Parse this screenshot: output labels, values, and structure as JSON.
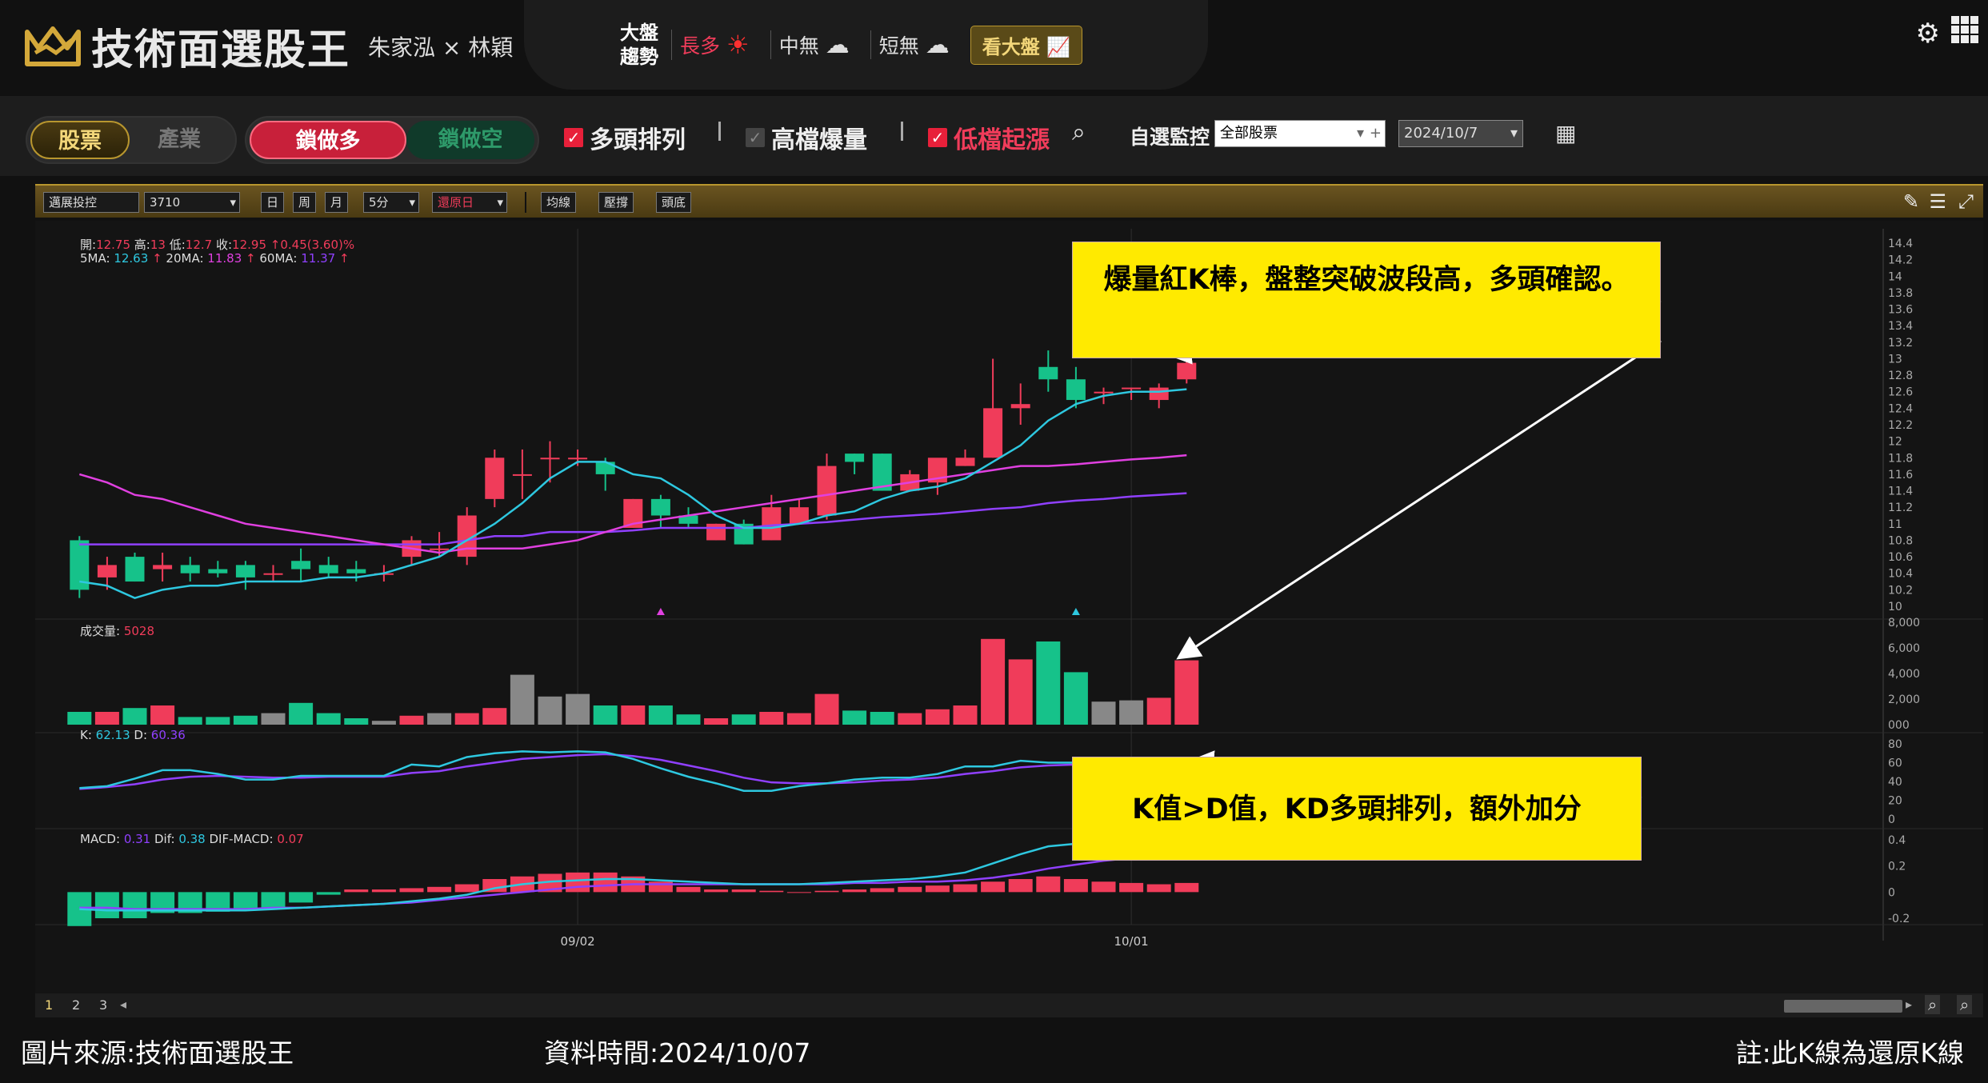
{
  "app": {
    "title": "技術面選股王",
    "authors": "朱家泓 × 林穎"
  },
  "market": {
    "label_line1": "大盤",
    "label_line2": "趨勢",
    "long": "長多",
    "mid": "中無",
    "short": "短無",
    "view_button": "看大盤"
  },
  "toolbar": {
    "seg1": [
      "股票",
      "產業"
    ],
    "seg2": [
      "鎖做多",
      "鎖做空"
    ],
    "filters": [
      {
        "label": "多頭排列",
        "checked": true
      },
      {
        "label": "高檔爆量",
        "checked": false
      },
      {
        "label": "低檔起漲",
        "checked": true
      }
    ],
    "monitor_label": "自選監控",
    "monitor_value": "全部股票",
    "date_value": "2024/10/7"
  },
  "chart_toolbar": {
    "stock_name": "邁展投控",
    "stock_code": "3710",
    "periods": [
      "日",
      "周",
      "月"
    ],
    "interval": "5分",
    "adjust": "還原日",
    "buttons": [
      "均線",
      "壓撐",
      "頭底"
    ]
  },
  "colors": {
    "up": "#f03c5a",
    "down": "#16c28a",
    "flat": "#888888",
    "ma5": "#2ec8e0",
    "ma20": "#e040e0",
    "ma60": "#9040ff",
    "k": "#2ec8e0",
    "d": "#9040ff",
    "dif": "#2ec8e0",
    "macd": "#9040ff",
    "callout": "#ffea00"
  },
  "info": {
    "ohlc": [
      {
        "label": "開:",
        "value": "12.75"
      },
      {
        "label": "高:",
        "value": "13"
      },
      {
        "label": "低:",
        "value": "12.7"
      },
      {
        "label": "收:",
        "value": "12.95"
      },
      {
        "label": "",
        "value": "↑0.45(3.60)%"
      }
    ],
    "ma": [
      {
        "label": "5MA:",
        "value": "12.63",
        "arrow": "↑"
      },
      {
        "label": "20MA:",
        "value": "11.83",
        "arrow": "↑"
      },
      {
        "label": "60MA:",
        "value": "11.37",
        "arrow": "↑"
      }
    ],
    "volume_label": "成交量:",
    "volume_value": "5028",
    "k_label": "K:",
    "k_value": "62.13",
    "d_label": "D:",
    "d_value": "60.36",
    "macd_label": "MACD:",
    "macd_value": "0.31",
    "dif_label": "Dif:",
    "dif_value": "0.38",
    "difmacd_label": "DIF-MACD:",
    "difmacd_value": "0.07"
  },
  "chart_data": {
    "type": "candlestick",
    "price_axis": {
      "min": 10,
      "max": 14.4,
      "ticks": [
        "14.4",
        "14.2",
        "14",
        "13.8",
        "13.6",
        "13.4",
        "13.2",
        "13",
        "12.8",
        "12.6",
        "12.4",
        "12.2",
        "12",
        "11.8",
        "11.6",
        "11.4",
        "11.2",
        "11",
        "10.8",
        "10.6",
        "10.4",
        "10.2",
        "10"
      ]
    },
    "volume_axis": {
      "min": 0,
      "max": 8000,
      "ticks": [
        "8,000",
        "6,000",
        "4,000",
        "2,000",
        "000"
      ]
    },
    "kd_axis": {
      "min": 0,
      "max": 80,
      "ticks": [
        "80",
        "60",
        "40",
        "20",
        "0"
      ]
    },
    "macd_axis": {
      "min": -0.2,
      "max": 0.4,
      "ticks": [
        "0.4",
        "0.2",
        "0",
        "-0.2"
      ]
    },
    "x_labels": [
      {
        "index": 18,
        "label": "09/02"
      },
      {
        "index": 38,
        "label": "10/01"
      }
    ],
    "candles": [
      [
        10.8,
        10.2,
        10.85,
        10.1
      ],
      [
        10.35,
        10.5,
        10.6,
        10.2
      ],
      [
        10.6,
        10.3,
        10.65,
        10.3
      ],
      [
        10.45,
        10.5,
        10.65,
        10.3
      ],
      [
        10.5,
        10.4,
        10.6,
        10.3
      ],
      [
        10.45,
        10.4,
        10.55,
        10.35
      ],
      [
        10.5,
        10.35,
        10.55,
        10.2
      ],
      [
        10.4,
        10.4,
        10.5,
        10.3
      ],
      [
        10.55,
        10.45,
        10.7,
        10.3
      ],
      [
        10.5,
        10.4,
        10.6,
        10.35
      ],
      [
        10.45,
        10.4,
        10.55,
        10.3
      ],
      [
        10.4,
        10.4,
        10.5,
        10.3
      ],
      [
        10.6,
        10.8,
        10.85,
        10.5
      ],
      [
        10.7,
        10.7,
        10.9,
        10.6
      ],
      [
        10.6,
        11.1,
        11.2,
        10.5
      ],
      [
        11.3,
        11.8,
        11.9,
        11.2
      ],
      [
        11.6,
        11.6,
        11.9,
        11.3
      ],
      [
        11.8,
        11.8,
        12.0,
        11.5
      ],
      [
        11.8,
        11.8,
        11.9,
        11.7
      ],
      [
        11.75,
        11.6,
        11.8,
        11.4
      ],
      [
        10.95,
        11.3,
        11.3,
        10.95
      ],
      [
        11.3,
        11.1,
        11.35,
        10.95
      ],
      [
        11.1,
        11.0,
        11.2,
        10.95
      ],
      [
        10.8,
        11.0,
        11.0,
        10.8
      ],
      [
        11.0,
        10.75,
        11.05,
        10.75
      ],
      [
        10.8,
        11.2,
        11.35,
        10.8
      ],
      [
        11.0,
        11.2,
        11.3,
        11.0
      ],
      [
        11.1,
        11.7,
        11.85,
        11.05
      ],
      [
        11.85,
        11.75,
        11.85,
        11.6
      ],
      [
        11.85,
        11.4,
        11.85,
        11.4
      ],
      [
        11.4,
        11.6,
        11.65,
        11.4
      ],
      [
        11.5,
        11.8,
        11.75,
        11.35
      ],
      [
        11.7,
        11.8,
        11.9,
        11.7
      ],
      [
        11.8,
        12.4,
        13.0,
        11.8
      ],
      [
        12.4,
        12.45,
        12.7,
        12.2
      ],
      [
        12.9,
        12.75,
        13.1,
        12.6
      ],
      [
        12.75,
        12.5,
        12.9,
        12.4
      ],
      [
        12.6,
        12.6,
        12.65,
        12.45
      ],
      [
        12.65,
        12.65,
        12.65,
        12.5
      ],
      [
        12.5,
        12.65,
        12.7,
        12.4
      ],
      [
        12.75,
        12.95,
        13.0,
        12.7
      ]
    ],
    "volume": [
      1000,
      1000,
      1300,
      1500,
      600,
      600,
      700,
      900,
      1700,
      900,
      500,
      300,
      700,
      900,
      900,
      1300,
      3900,
      2200,
      2400,
      1500,
      1500,
      1500,
      800,
      500,
      800,
      1000,
      900,
      2400,
      1100,
      1000,
      900,
      1200,
      1500,
      6700,
      5100,
      6500,
      4100,
      1800,
      1900,
      2100,
      5028
    ],
    "ma5": [
      10.3,
      10.25,
      10.1,
      10.2,
      10.25,
      10.25,
      10.3,
      10.3,
      10.3,
      10.35,
      10.35,
      10.4,
      10.5,
      10.6,
      10.8,
      11.0,
      11.25,
      11.55,
      11.75,
      11.75,
      11.6,
      11.55,
      11.35,
      11.1,
      10.95,
      10.95,
      11.0,
      11.1,
      11.15,
      11.3,
      11.4,
      11.45,
      11.55,
      11.75,
      11.95,
      12.25,
      12.45,
      12.55,
      12.6,
      12.6,
      12.63
    ],
    "ma20": [
      11.6,
      11.5,
      11.35,
      11.3,
      11.2,
      11.1,
      11.0,
      10.95,
      10.9,
      10.85,
      10.8,
      10.75,
      10.7,
      10.65,
      10.7,
      10.7,
      10.7,
      10.75,
      10.8,
      10.9,
      11.0,
      11.05,
      11.1,
      11.15,
      11.2,
      11.25,
      11.3,
      11.35,
      11.4,
      11.45,
      11.5,
      11.55,
      11.6,
      11.65,
      11.7,
      11.7,
      11.72,
      11.75,
      11.78,
      11.8,
      11.83
    ],
    "ma60": [
      10.75,
      10.75,
      10.75,
      10.75,
      10.75,
      10.75,
      10.75,
      10.75,
      10.75,
      10.75,
      10.75,
      10.75,
      10.75,
      10.75,
      10.8,
      10.85,
      10.85,
      10.9,
      10.9,
      10.9,
      10.92,
      10.95,
      10.95,
      10.95,
      10.95,
      10.98,
      11.0,
      11.02,
      11.05,
      11.08,
      11.1,
      11.12,
      11.15,
      11.18,
      11.2,
      11.25,
      11.28,
      11.3,
      11.33,
      11.35,
      11.37
    ],
    "k": [
      33,
      35,
      43,
      52,
      52,
      48,
      42,
      42,
      46,
      46,
      46,
      46,
      58,
      56,
      66,
      70,
      72,
      71,
      72,
      71,
      64,
      54,
      45,
      38,
      30,
      30,
      35,
      38,
      42,
      44,
      44,
      48,
      56,
      56,
      62,
      60,
      60,
      56,
      52,
      43,
      62.13
    ],
    "d": [
      32,
      34,
      37,
      42,
      45,
      46,
      45,
      44,
      44,
      45,
      45,
      45,
      49,
      51,
      56,
      60,
      64,
      66,
      68,
      69,
      67,
      63,
      57,
      51,
      44,
      39,
      38,
      38,
      39,
      41,
      42,
      44,
      48,
      51,
      55,
      57,
      58,
      58,
      56,
      52,
      60.36
    ],
    "dif": [
      -0.13,
      -0.14,
      -0.14,
      -0.14,
      -0.14,
      -0.14,
      -0.14,
      -0.13,
      -0.12,
      -0.11,
      -0.1,
      -0.09,
      -0.07,
      -0.05,
      -0.02,
      0.03,
      0.06,
      0.08,
      0.09,
      0.1,
      0.1,
      0.09,
      0.08,
      0.07,
      0.06,
      0.06,
      0.06,
      0.07,
      0.08,
      0.09,
      0.1,
      0.12,
      0.15,
      0.22,
      0.29,
      0.35,
      0.37,
      0.37,
      0.37,
      0.36,
      0.38
    ],
    "macd": [
      -0.12,
      -0.12,
      -0.13,
      -0.13,
      -0.13,
      -0.13,
      -0.13,
      -0.12,
      -0.12,
      -0.11,
      -0.1,
      -0.09,
      -0.08,
      -0.06,
      -0.04,
      -0.02,
      0,
      0.02,
      0.04,
      0.05,
      0.06,
      0.06,
      0.06,
      0.06,
      0.06,
      0.06,
      0.06,
      0.06,
      0.07,
      0.07,
      0.08,
      0.08,
      0.09,
      0.11,
      0.14,
      0.18,
      0.21,
      0.24,
      0.26,
      0.28,
      0.31
    ],
    "osc": [
      -0.26,
      -0.2,
      -0.2,
      -0.16,
      -0.16,
      -0.15,
      -0.14,
      -0.12,
      -0.08,
      -0.02,
      0.02,
      0.02,
      0.03,
      0.04,
      0.06,
      0.1,
      0.12,
      0.14,
      0.15,
      0.15,
      0.12,
      0.08,
      0.04,
      0.02,
      0.02,
      0.01,
      0.0,
      0.01,
      0.02,
      0.03,
      0.04,
      0.05,
      0.06,
      0.08,
      0.1,
      0.12,
      0.1,
      0.08,
      0.07,
      0.06,
      0.07
    ],
    "markers": [
      {
        "index": 21,
        "color": "#e040e0"
      },
      {
        "index": 36,
        "color": "#2ec8e0"
      }
    ]
  },
  "callouts": [
    {
      "text": "爆量紅K棒，盤整突破波段高，多頭確認。"
    },
    {
      "text": "K值>D值，KD多頭排列，額外加分"
    }
  ],
  "pager": {
    "pages": [
      "1",
      "2",
      "3"
    ]
  },
  "footer": {
    "source": "圖片來源:技術面選股王",
    "data_time": "資料時間:2024/10/07",
    "note": "註:此K線為還原K線"
  }
}
